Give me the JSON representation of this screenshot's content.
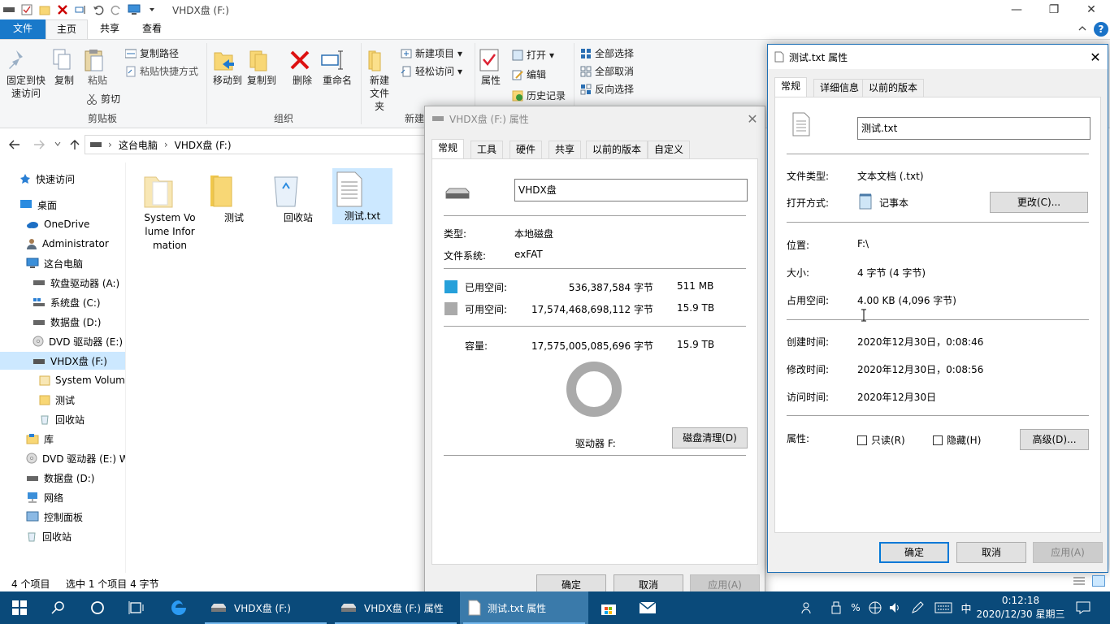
{
  "window": {
    "title": "VHDX盘 (F:)"
  },
  "ribbon": {
    "tabs": [
      "文件",
      "主页",
      "共享",
      "查看"
    ],
    "clipboard": {
      "pin": "固定到快速访问",
      "copy": "复制",
      "paste": "粘贴",
      "copy_path": "复制路径",
      "paste_shortcut": "粘贴快捷方式",
      "cut": "剪切",
      "group": "剪贴板"
    },
    "organize": {
      "move_to": "移动到",
      "copy_to": "复制到",
      "delete": "删除",
      "rename": "重命名",
      "group": "组织"
    },
    "new": {
      "new_folder": "新建文件夹",
      "new_item": "新建项目",
      "easy_access": "轻松访问",
      "group": "新建"
    },
    "open": {
      "properties": "属性",
      "open": "打开",
      "edit": "编辑",
      "history": "历史记录"
    },
    "select": {
      "select_all": "全部选择",
      "select_none": "全部取消",
      "invert": "反向选择"
    }
  },
  "address": {
    "segments": [
      "这台电脑",
      "VHDX盘 (F:)"
    ]
  },
  "nav": {
    "items": [
      "快速访问",
      "桌面",
      "OneDrive",
      "Administrator",
      "这台电脑",
      "软盘驱动器 (A:)",
      "系统盘 (C:)",
      "数据盘 (D:)",
      "DVD 驱动器 (E:) V",
      "VHDX盘 (F:)",
      "System Volume",
      "测试",
      "回收站",
      "库",
      "DVD 驱动器 (E:) W",
      "数据盘 (D:)",
      "网络",
      "控制面板",
      "回收站"
    ]
  },
  "files": [
    {
      "name": "System Volume Information"
    },
    {
      "name": "测试"
    },
    {
      "name": "回收站"
    },
    {
      "name": "测试.txt"
    }
  ],
  "status": {
    "count": "4 个项目",
    "selected": "选中 1 个项目  4 字节"
  },
  "drive_dialog": {
    "title": "VHDX盘 (F:) 属性",
    "tabs": [
      "常规",
      "工具",
      "硬件",
      "共享",
      "以前的版本",
      "自定义"
    ],
    "name": "VHDX盘",
    "type_label": "类型:",
    "type_value": "本地磁盘",
    "fs_label": "文件系统:",
    "fs_value": "exFAT",
    "used_label": "已用空间:",
    "used_bytes": "536,387,584 字节",
    "used_size": "511 MB",
    "free_label": "可用空间:",
    "free_bytes": "17,574,468,698,112 字节",
    "free_size": "15.9 TB",
    "cap_label": "容量:",
    "cap_bytes": "17,575,005,085,696 字节",
    "cap_size": "15.9 TB",
    "drive_label": "驱动器 F:",
    "cleanup": "磁盘清理(D)",
    "ok": "确定",
    "cancel": "取消",
    "apply": "应用(A)",
    "used_fraction": 3e-05,
    "used_color": "#26a0da",
    "free_color": "#aaaaaa"
  },
  "file_dialog": {
    "title": "测试.txt 属性",
    "tabs": [
      "常规",
      "详细信息",
      "以前的版本"
    ],
    "name": "测试.txt",
    "type_label": "文件类型:",
    "type_value": "文本文档 (.txt)",
    "open_label": "打开方式:",
    "open_value": "记事本",
    "change": "更改(C)...",
    "loc_label": "位置:",
    "loc_value": "F:\\",
    "size_label": "大小:",
    "size_value": "4 字节 (4 字节)",
    "disk_label": "占用空间:",
    "disk_value": "4.00 KB (4,096 字节)",
    "created_label": "创建时间:",
    "created_value": "2020年12月30日，0:08:46",
    "modified_label": "修改时间:",
    "modified_value": "2020年12月30日，0:08:56",
    "accessed_label": "访问时间:",
    "accessed_value": "2020年12月30日",
    "attr_label": "属性:",
    "readonly": "只读(R)",
    "hidden": "隐藏(H)",
    "advanced": "高级(D)...",
    "ok": "确定",
    "cancel": "取消",
    "apply": "应用(A)"
  },
  "taskbar": {
    "apps": [
      "VHDX盘 (F:)",
      "VHDX盘 (F:) 属性",
      "测试.txt 属性"
    ],
    "ime": "中",
    "time": "0:12:18",
    "date": "2020/12/30 星期三"
  }
}
